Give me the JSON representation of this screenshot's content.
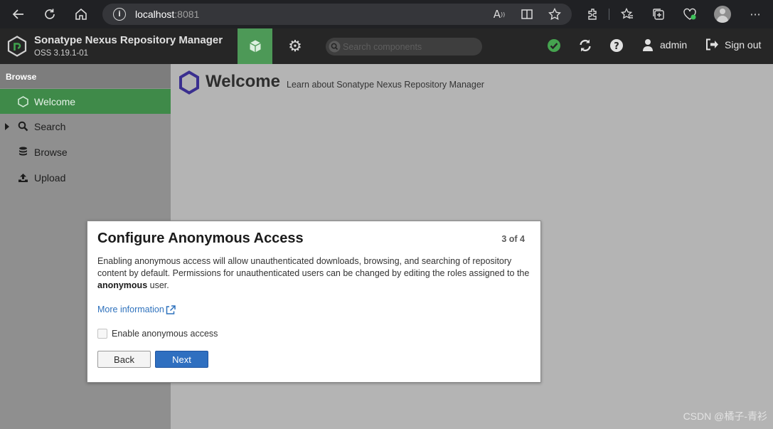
{
  "browser": {
    "url_host": "localhost",
    "url_port": ":8081",
    "icons": [
      "back-arrow-icon",
      "refresh-icon",
      "home-icon",
      "info-icon",
      "read-aloud-icon",
      "immersive-reader-icon",
      "favorite-star-icon",
      "extensions-icon",
      "favorites-icon",
      "collections-icon",
      "browser-essentials-icon",
      "profile-icon",
      "more-icon"
    ]
  },
  "header": {
    "title": "Sonatype Nexus Repository Manager",
    "version": "OSS 3.19.1-01",
    "search_placeholder": "Search components",
    "user": "admin",
    "sign_out": "Sign out",
    "accent_color": "#4d9957"
  },
  "sidebar": {
    "heading": "Browse",
    "items": [
      {
        "label": "Welcome",
        "icon": "hexagon-icon",
        "active": true
      },
      {
        "label": "Search",
        "icon": "search-icon",
        "expandable": true
      },
      {
        "label": "Browse",
        "icon": "database-icon"
      },
      {
        "label": "Upload",
        "icon": "upload-icon"
      }
    ]
  },
  "main": {
    "title": "Welcome",
    "subtitle": "Learn about Sonatype Nexus Repository Manager"
  },
  "dialog": {
    "title": "Configure Anonymous Access",
    "step": "3 of 4",
    "body_before": "Enabling anonymous access will allow unauthenticated downloads, browsing, and searching of repository content by default. Permissions for unauthenticated users can be changed by editing the roles assigned to the ",
    "body_bold": "anonymous",
    "body_after": " user.",
    "link": "More information",
    "checkbox_label": "Enable anonymous access",
    "checkbox_checked": false,
    "back_label": "Back",
    "next_label": "Next"
  },
  "watermark": "CSDN @橘子-青衫"
}
